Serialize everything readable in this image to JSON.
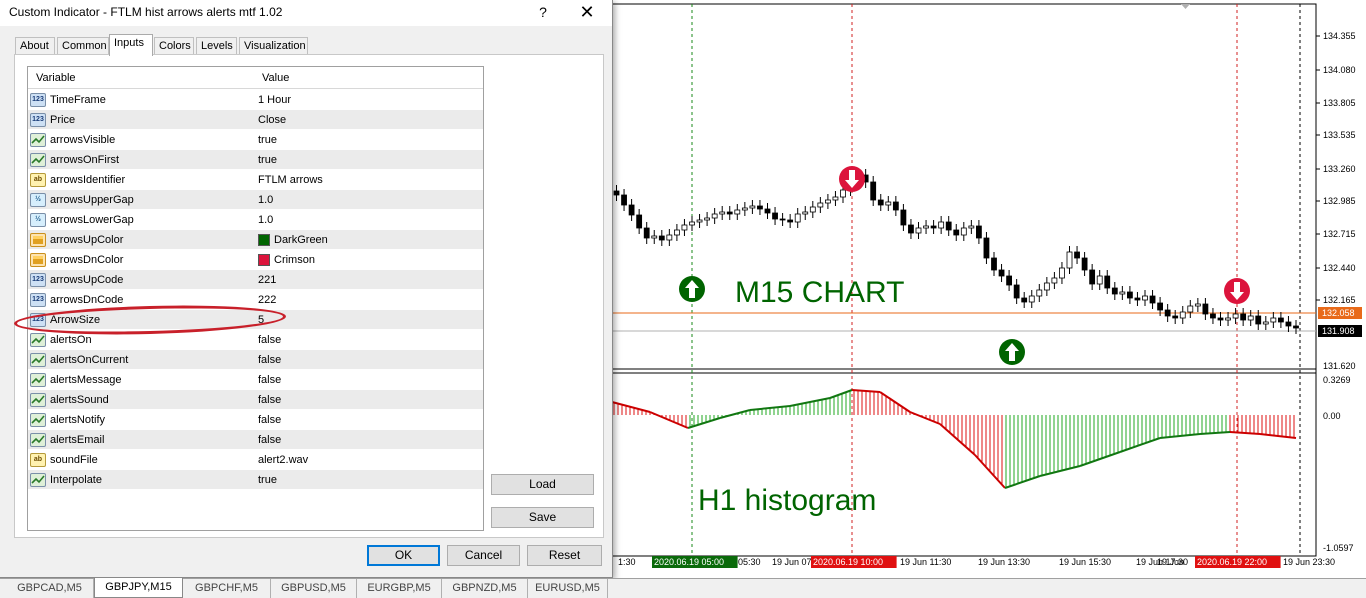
{
  "dialog": {
    "title": "Custom Indicator - FTLM hist arrows alerts mtf 1.02",
    "help_label": "?",
    "close_label": "✕",
    "tabs": [
      "About",
      "Common",
      "Inputs",
      "Colors",
      "Levels",
      "Visualization"
    ],
    "active_tab": "Inputs",
    "grid_headers": {
      "variable": "Variable",
      "value": "Value"
    },
    "params": [
      {
        "name": "TimeFrame",
        "value": "1 Hour",
        "type": "num"
      },
      {
        "name": "Price",
        "value": "Close",
        "type": "num"
      },
      {
        "name": "arrowsVisible",
        "value": "true",
        "type": "bool"
      },
      {
        "name": "arrowsOnFirst",
        "value": "true",
        "type": "bool"
      },
      {
        "name": "arrowsIdentifier",
        "value": "FTLM arrows",
        "type": "str"
      },
      {
        "name": "arrowsUpperGap",
        "value": "1.0",
        "type": "dbl"
      },
      {
        "name": "arrowsLowerGap",
        "value": "1.0",
        "type": "dbl"
      },
      {
        "name": "arrowsUpColor",
        "value": "DarkGreen",
        "type": "col",
        "swatch": "#006400"
      },
      {
        "name": "arrowsDnColor",
        "value": "Crimson",
        "type": "col",
        "swatch": "#dc143c"
      },
      {
        "name": "arrowsUpCode",
        "value": "221",
        "type": "num"
      },
      {
        "name": "arrowsDnCode",
        "value": "222",
        "type": "num"
      },
      {
        "name": "ArrowSize",
        "value": "5",
        "type": "num"
      },
      {
        "name": "alertsOn",
        "value": "false",
        "type": "bool"
      },
      {
        "name": "alertsOnCurrent",
        "value": "false",
        "type": "bool"
      },
      {
        "name": "alertsMessage",
        "value": "false",
        "type": "bool"
      },
      {
        "name": "alertsSound",
        "value": "false",
        "type": "bool"
      },
      {
        "name": "alertsNotify",
        "value": "false",
        "type": "bool"
      },
      {
        "name": "alertsEmail",
        "value": "false",
        "type": "bool"
      },
      {
        "name": "soundFile",
        "value": "alert2.wav",
        "type": "str"
      },
      {
        "name": "Interpolate",
        "value": "true",
        "type": "bool"
      }
    ],
    "icon_glyphs": {
      "num": "123",
      "bool": "",
      "str": "ab",
      "dbl": "½",
      "col": ""
    },
    "buttons": {
      "load": "Load",
      "save": "Save",
      "ok": "OK",
      "cancel": "Cancel",
      "reset": "Reset"
    }
  },
  "chart": {
    "main_label": "M15  CHART",
    "sub_label": "H1  histogram",
    "label_color": "#006400",
    "price_axis": [
      "134.355",
      "134.080",
      "133.805",
      "133.535",
      "133.260",
      "132.985",
      "132.715",
      "132.440",
      "132.165",
      "132.058",
      "131.908",
      "131.620"
    ],
    "bid_price": "132.058",
    "ask_price": "131.908",
    "bid_color": "#e86a1a",
    "hist_axis": [
      "0.3269",
      "0.00",
      "-1.0597"
    ],
    "time_axis": [
      "1:30",
      "2020.06.19 05:00",
      "05:30",
      "19 Jun 07",
      "2020.06.19 10:00",
      "19 Jun 11:30",
      "19 Jun 13:30",
      "19 Jun 15:30",
      "19 Jun 17:30",
      "19 Jun",
      "2020.06.19 22:00",
      "19 Jun 23:30"
    ],
    "up_color": "#006400",
    "down_color": "#dc143c",
    "hist_up_color": "#22aa22",
    "hist_down_color": "#dd1111"
  },
  "symbol_tabs": [
    "GBPCAD,M5",
    "GBPJPY,M15",
    "GBPCHF,M5",
    "GBPUSD,M5",
    "EURGBP,M5",
    "GBPNZD,M5",
    "EURUSD,M5"
  ],
  "active_symbol_tab": "GBPJPY,M15"
}
